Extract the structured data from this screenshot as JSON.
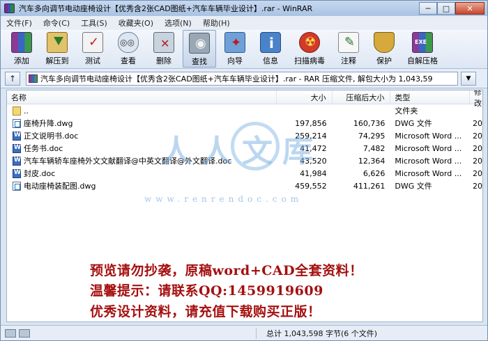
{
  "window": {
    "title": "汽车多向调节电动座椅设计【优秀含2张CAD图纸+汽车车辆毕业设计】.rar - WinRAR",
    "minimize": "─",
    "maximize": "□",
    "close": "✕"
  },
  "menu": [
    "文件(F)",
    "命令(C)",
    "工具(S)",
    "收藏夹(O)",
    "选项(N)",
    "帮助(H)"
  ],
  "toolbar": [
    {
      "label": "添加",
      "icon": "add-icon"
    },
    {
      "label": "解压到",
      "icon": "extract-icon"
    },
    {
      "label": "测试",
      "icon": "test-icon"
    },
    {
      "label": "查看",
      "icon": "view-icon"
    },
    {
      "label": "删除",
      "icon": "delete-icon"
    },
    {
      "label": "查找",
      "icon": "find-icon"
    },
    {
      "label": "向导",
      "icon": "wizard-icon"
    },
    {
      "label": "信息",
      "icon": "info-icon"
    },
    {
      "label": "扫描病毒",
      "icon": "scan-virus-icon"
    },
    {
      "label": "注释",
      "icon": "comment-icon"
    },
    {
      "label": "保护",
      "icon": "protect-icon"
    },
    {
      "label": "自解压格",
      "icon": "sfx-icon"
    }
  ],
  "address": {
    "up": "↑",
    "path": "汽车多向调节电动座椅设计【优秀含2张CAD图纸+汽车车辆毕业设计】.rar - RAR 压缩文件, 解包大小为 1,043,59",
    "dropdown": "▼"
  },
  "columns": {
    "name": "名称",
    "size": "大小",
    "packed": "压缩后大小",
    "type": "类型",
    "modified": "修改"
  },
  "files": [
    {
      "name": "..",
      "size": "",
      "packed": "",
      "type": "文件夹",
      "mod": "",
      "kind": "folder"
    },
    {
      "name": "座椅升降.dwg",
      "size": "197,856",
      "packed": "160,736",
      "type": "DWG 文件",
      "mod": "20",
      "kind": "dwg"
    },
    {
      "name": "正文说明书.doc",
      "size": "259,214",
      "packed": "74,295",
      "type": "Microsoft Word ...",
      "mod": "20",
      "kind": "doc"
    },
    {
      "name": "任务书.doc",
      "size": "41,472",
      "packed": "7,482",
      "type": "Microsoft Word ...",
      "mod": "20",
      "kind": "doc"
    },
    {
      "name": "汽车车辆轿车座椅外文文献翻译@中英文翻译@外文翻译.doc",
      "size": "43,520",
      "packed": "12,364",
      "type": "Microsoft Word ...",
      "mod": "20",
      "kind": "doc"
    },
    {
      "name": "封皮.doc",
      "size": "41,984",
      "packed": "6,626",
      "type": "Microsoft Word ...",
      "mod": "20",
      "kind": "doc"
    },
    {
      "name": "电动座椅装配图.dwg",
      "size": "459,552",
      "packed": "411,261",
      "type": "DWG 文件",
      "mod": "20",
      "kind": "dwg"
    }
  ],
  "watermark": {
    "chars": "人人文库",
    "url": "www.renrendoc.com"
  },
  "promo": {
    "line1": "预览请勿抄袭，原稿word+CAD全套资料！",
    "line2": "温馨提示：请联系QQ:1459919609",
    "line3": "优秀设计资料，请充值下载购买正版！"
  },
  "status": {
    "text": "总计 1,043,598 字节(6 个文件)"
  }
}
